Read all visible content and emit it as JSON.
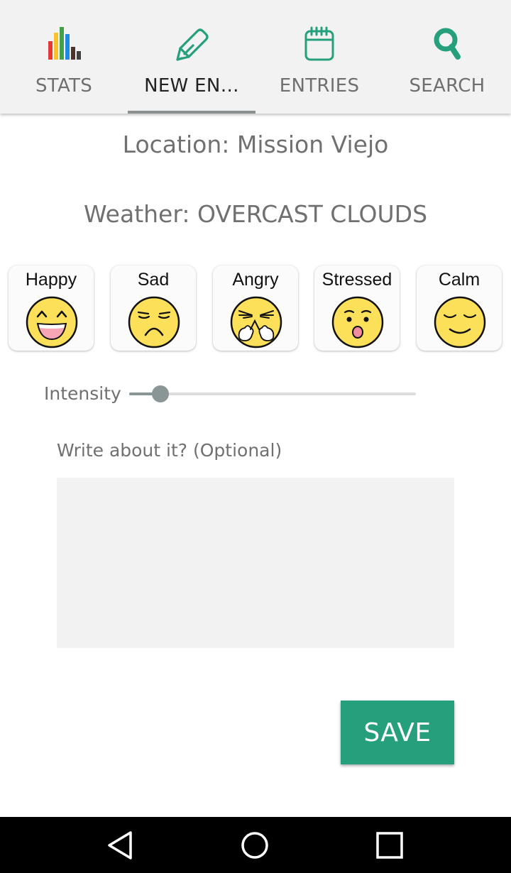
{
  "tabs": [
    {
      "label": "STATS",
      "icon": "bar-chart-icon",
      "active": false
    },
    {
      "label": "NEW EN…",
      "icon": "pen-icon",
      "active": true
    },
    {
      "label": "ENTRIES",
      "icon": "calendar-icon",
      "active": false
    },
    {
      "label": "SEARCH",
      "icon": "search-icon",
      "active": false
    }
  ],
  "location_text": "Location: Mission Viejo",
  "weather_text": "Weather: OVERCAST CLOUDS",
  "moods": [
    {
      "label": "Happy",
      "icon": "happy-face-icon"
    },
    {
      "label": "Sad",
      "icon": "sad-face-icon"
    },
    {
      "label": "Angry",
      "icon": "angry-face-icon"
    },
    {
      "label": "Stressed",
      "icon": "stressed-face-icon"
    },
    {
      "label": "Calm",
      "icon": "calm-face-icon"
    }
  ],
  "intensity": {
    "label": "Intensity",
    "value": 0.11
  },
  "journal": {
    "label": "Write about it? (Optional)",
    "value": "",
    "placeholder": ""
  },
  "save_label": "SAVE",
  "colors": {
    "accent": "#26a07c",
    "tab_bar_bg": "#f2f2f2",
    "face_yellow": "#fce05a",
    "slider_thumb": "#8a9595"
  },
  "system_nav": [
    {
      "icon": "back-triangle-icon"
    },
    {
      "icon": "home-circle-icon"
    },
    {
      "icon": "recents-square-icon"
    }
  ]
}
